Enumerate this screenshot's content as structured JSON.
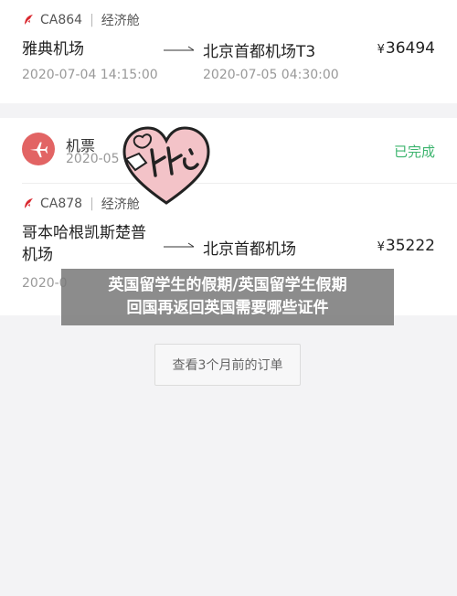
{
  "flight1": {
    "airline_code": "CA864",
    "cabin": "经济舱",
    "from": "雅典机场",
    "to": "北京首都机场T3",
    "currency": "¥",
    "price": "36494",
    "depart_time": "2020-07-04 14:15:00",
    "arrive_time": "2020-07-05 04:30:00"
  },
  "order": {
    "type": "机票",
    "date": "2020-05",
    "status": "已完成",
    "status_color": "#3cb46e",
    "icon": "airplane-icon"
  },
  "flight2": {
    "airline_code": "CA878",
    "cabin": "经济舱",
    "from_line1": "哥本哈根凯斯楚普",
    "from_line2": "机场",
    "to": "北京首都机场",
    "currency": "¥",
    "price": "35222",
    "depart_time_partial": "2020-0"
  },
  "overlay": {
    "line1": "英国留学生的假期/英国留学生假期",
    "line2": "回国再返回英国需要哪些证件"
  },
  "more_orders_label": "查看3个月前的订单",
  "colors": {
    "airline_red": "#d9282f",
    "order_icon_bg": "#e26464"
  }
}
